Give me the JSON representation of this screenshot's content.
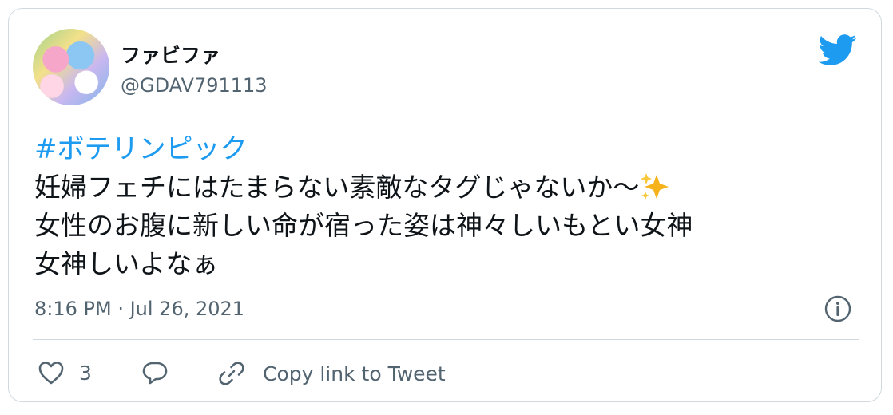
{
  "author": {
    "display_name": "ファビファ",
    "handle": "@GDAV791113",
    "avatar_icon": "avatar-anime-icon"
  },
  "tweet": {
    "hashtag": "#ボテリンピック",
    "line1": "妊婦フェチにはたまらない素敵なタグじゃないか〜",
    "line2": "女性のお腹に新しい命が宿った姿は神々しいもとい女神",
    "line3": "女神しいよなぁ",
    "emoji": "sparkles-icon"
  },
  "meta": {
    "timestamp": "8:16 PM · Jul 26, 2021"
  },
  "actions": {
    "like_count": "3",
    "copy_link_label": "Copy link to Tweet"
  },
  "colors": {
    "brand": "#1d9bf0",
    "text": "#0f1419",
    "secondary": "#536471",
    "border": "#cfd9de"
  }
}
